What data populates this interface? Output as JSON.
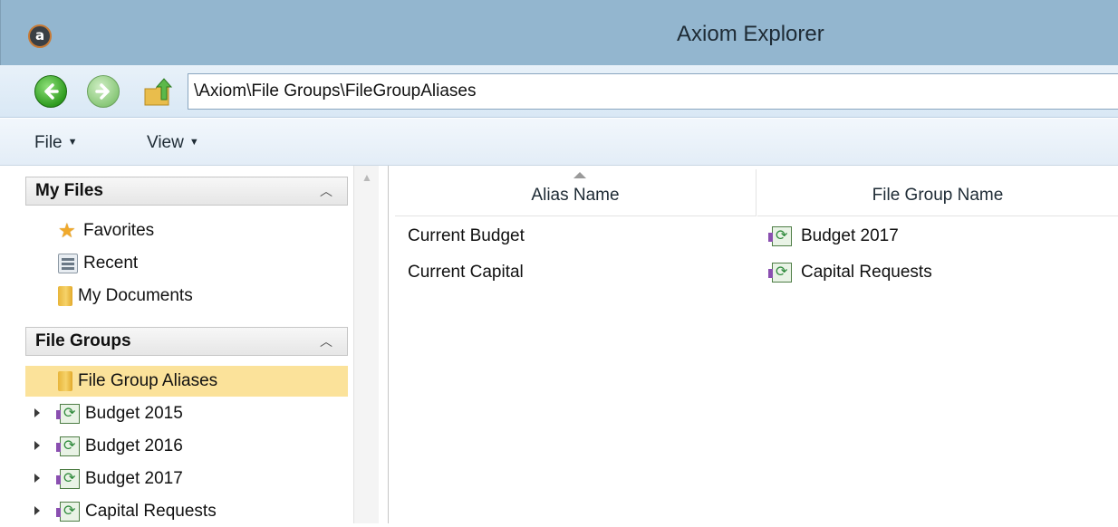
{
  "window": {
    "title": "Axiom Explorer",
    "app_icon_letter": "a"
  },
  "address": {
    "path": "\\Axiom\\File Groups\\FileGroupAliases"
  },
  "menu": {
    "file": "File",
    "view": "View"
  },
  "left": {
    "my_files_header": "My Files",
    "my_files": [
      {
        "label": "Favorites",
        "icon": "star-icon"
      },
      {
        "label": "Recent",
        "icon": "recent-icon"
      },
      {
        "label": "My Documents",
        "icon": "folder-icon"
      }
    ],
    "file_groups_header": "File Groups",
    "file_groups": [
      {
        "label": "File Group Aliases",
        "icon": "folder-icon",
        "selected": true
      },
      {
        "label": "Budget 2015",
        "icon": "file-group-icon"
      },
      {
        "label": "Budget 2016",
        "icon": "file-group-icon"
      },
      {
        "label": "Budget 2017",
        "icon": "file-group-icon"
      },
      {
        "label": "Capital Requests",
        "icon": "file-group-icon"
      }
    ]
  },
  "table": {
    "columns": [
      "Alias Name",
      "File Group Name"
    ],
    "rows": [
      {
        "alias": "Current Budget",
        "file_group": "Budget 2017"
      },
      {
        "alias": "Current Capital",
        "file_group": "Capital Requests"
      }
    ]
  },
  "colors": {
    "titlebar": "#93b6cf",
    "selection": "#fbe29a"
  }
}
